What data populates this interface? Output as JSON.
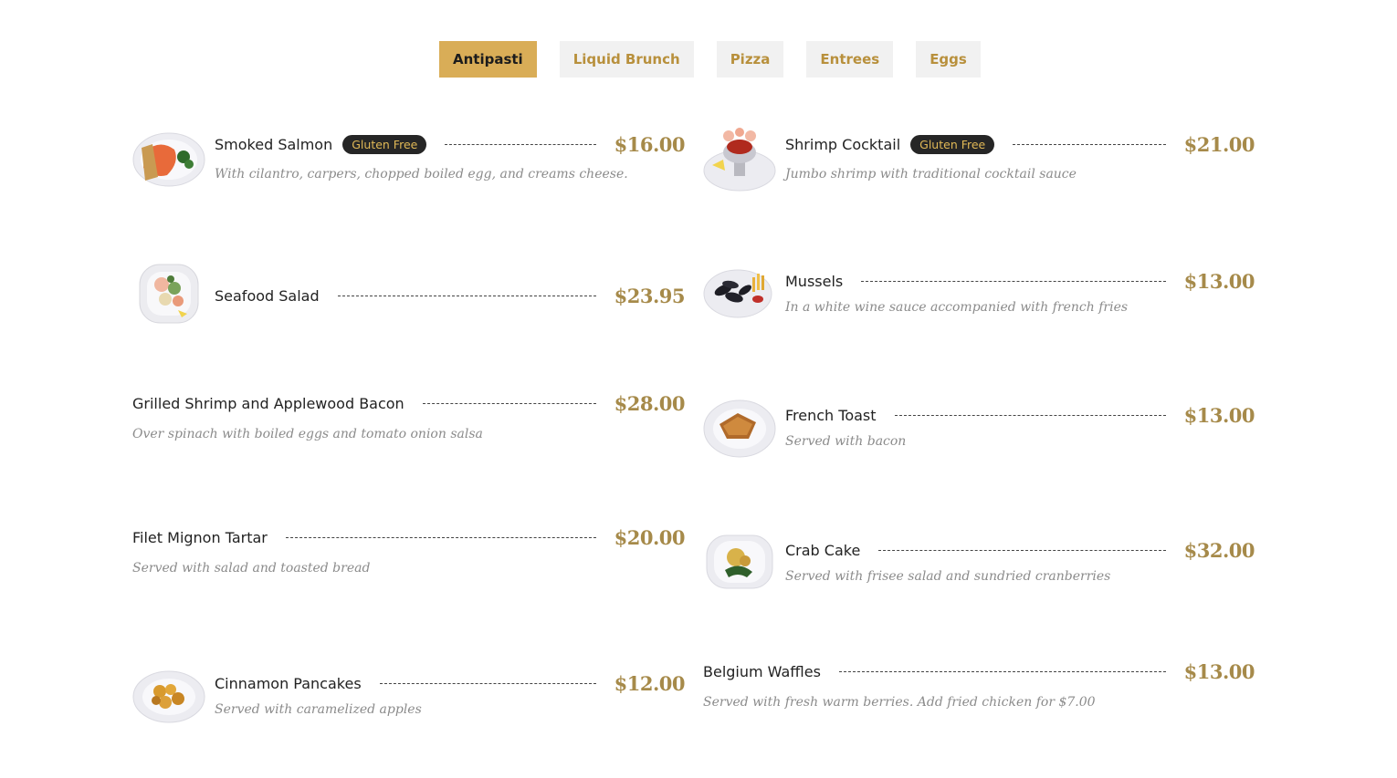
{
  "tabs": [
    "Antipasti",
    "Liquid Brunch",
    "Pizza",
    "Entrees",
    "Eggs"
  ],
  "active_tab": "Antipasti",
  "menu": {
    "left": [
      {
        "name": "Smoked Salmon",
        "badge": "Gluten Free",
        "price": "$16.00",
        "desc": "With cilantro, carpers, chopped boiled egg, and creams cheese.",
        "image": "smoked-salmon-plate"
      },
      {
        "name": "Seafood Salad",
        "price": "$23.95",
        "image": "seafood-salad-plate"
      },
      {
        "name": "Grilled Shrimp and Applewood Bacon",
        "price": "$28.00",
        "desc": "Over spinach with boiled eggs and tomato onion salsa"
      },
      {
        "name": "Filet Mignon Tartar",
        "price": "$20.00",
        "desc": "Served with salad and toasted bread"
      },
      {
        "name": "Cinnamon Pancakes",
        "price": "$12.00",
        "desc": "Served with caramelized apples",
        "image": "cinnamon-pancakes-plate"
      }
    ],
    "right": [
      {
        "name": "Shrimp Cocktail",
        "badge": "Gluten Free",
        "price": "$21.00",
        "desc": "Jumbo shrimp with traditional cocktail sauce",
        "image": "shrimp-cocktail-dish"
      },
      {
        "name": "Mussels",
        "price": "$13.00",
        "desc": "In a white wine sauce accompanied with french fries",
        "image": "mussels-plate"
      },
      {
        "name": "French Toast",
        "price": "$13.00",
        "desc": "Served with bacon",
        "image": "french-toast-plate"
      },
      {
        "name": "Crab Cake",
        "price": "$32.00",
        "desc": "Served with frisee salad and sundried cranberries",
        "image": "crab-cake-plate"
      },
      {
        "name": "Belgium Waffles",
        "price": "$13.00",
        "desc": "Served with fresh warm berries. Add fried chicken for $7.00"
      }
    ]
  },
  "colors": {
    "accent": "#d9ad57",
    "price": "#a68a4a",
    "badge_bg": "#262626",
    "badge_text": "#e0b856"
  }
}
